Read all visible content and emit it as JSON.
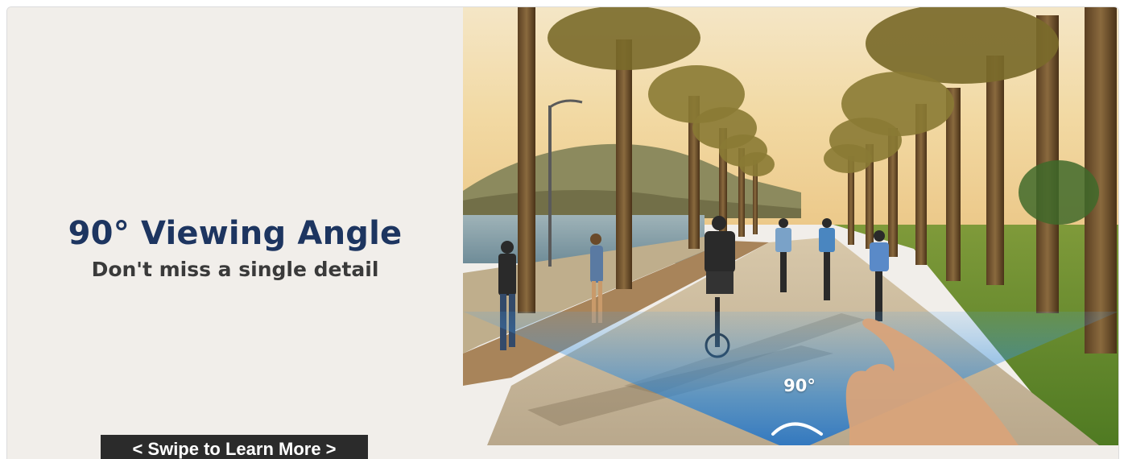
{
  "feature": {
    "headline": "90° Viewing Angle",
    "subhead": "Don't miss a single detail",
    "swipe_label": "< Swipe to Learn More >"
  },
  "photo": {
    "angle_label": "90°",
    "angle_value_degrees": 90
  },
  "colors": {
    "headline": "#1d3560",
    "subhead": "#3a3a3a",
    "panel_background": "#f1eeea",
    "button_background": "#2b2b2b",
    "view_cone": "#2a86d8"
  }
}
